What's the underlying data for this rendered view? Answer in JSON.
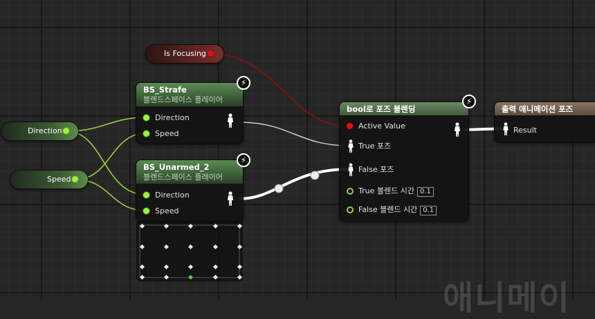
{
  "variables": {
    "is_focusing": "Is Focusing",
    "direction": "Direction",
    "speed": "Speed"
  },
  "nodes": {
    "bs_strafe": {
      "title": "BS_Strafe",
      "subtitle": "블렌드스페이스 플레이어",
      "pin_direction": "Direction",
      "pin_speed": "Speed"
    },
    "bs_unarmed": {
      "title": "BS_Unarmed_2",
      "subtitle": "블렌드스페이스 플레이어",
      "pin_direction": "Direction",
      "pin_speed": "Speed"
    },
    "blend_bool": {
      "title": "bool로 포즈 블렌딩",
      "pin_active": "Active Value",
      "pin_true_pose": "True 포즈",
      "pin_false_pose": "False 포즈",
      "pin_true_time": "True 블렌드 시간",
      "true_time_value": "0.1",
      "pin_false_time": "False 블렌드 시간",
      "false_time_value": "0.1"
    },
    "output_pose": {
      "title": "출력 애니메이션 포즈",
      "pin_result": "Result"
    }
  },
  "watermark": "애니메이",
  "colors": {
    "exec_wire": "#ffffff",
    "float_wire": "#9ecf3a",
    "bool_wire": "#8e0e0e",
    "node_green": "#4e7a48"
  }
}
